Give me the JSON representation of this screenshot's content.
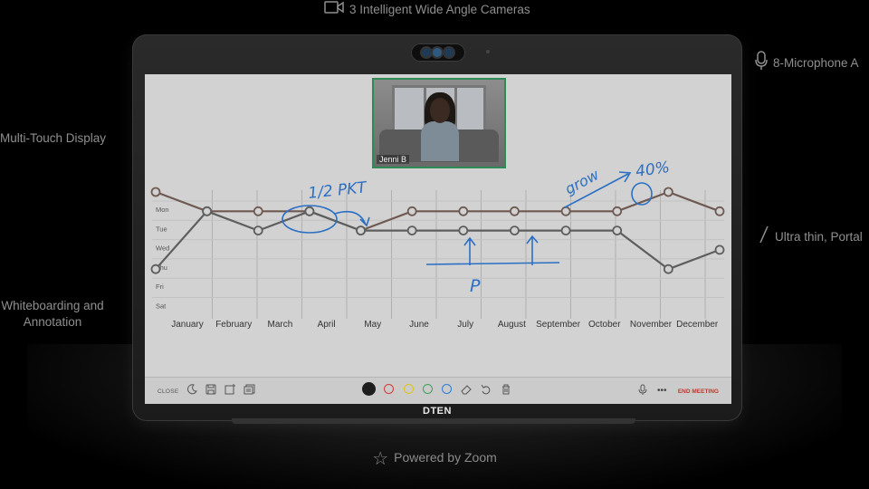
{
  "features": {
    "cameras": "3 Intelligent Wide Angle Cameras",
    "microphones": "8-Microphone A",
    "touch": "Multi-Touch Display",
    "thin": "Ultra thin, Portal",
    "whiteboard": "Whiteboarding and Annotation"
  },
  "device": {
    "brand": "DTEN"
  },
  "video": {
    "participant_name": "Jenni B"
  },
  "chart_data": {
    "type": "line",
    "categories": [
      "January",
      "February",
      "March",
      "April",
      "May",
      "June",
      "July",
      "August",
      "September",
      "October",
      "November",
      "December"
    ],
    "y_categories": [
      "Mon",
      "Tue",
      "Wed",
      "Thu",
      "Fri",
      "Sat"
    ],
    "series": [
      {
        "values": [
          "Mon",
          "Tue",
          "Tue",
          "Tue",
          "Wed",
          "Tue",
          "Tue",
          "Tue",
          "Tue",
          "Tue",
          "Mon",
          "Tue"
        ],
        "color": "#6e5a52"
      },
      {
        "values": [
          "Fri",
          "Tue",
          "Wed",
          "Tue",
          "Wed",
          "Wed",
          "Wed",
          "Wed",
          "Wed",
          "Wed",
          "Fri",
          "Thu"
        ],
        "color": "#5e5e5e"
      }
    ],
    "plotted_x": [
      0,
      1,
      2,
      3,
      4,
      5,
      6,
      7,
      8,
      9,
      10,
      11
    ],
    "annotations": [
      "1/2 PKT",
      "P",
      "grow",
      "40%"
    ],
    "grid": true
  },
  "toolbar": {
    "close_label": "CLOSE",
    "end_meeting_label": "END MEETING",
    "colors": [
      "#1e1e1e",
      "#d23b3b",
      "#e0c21b",
      "#3aa35a",
      "#2e7bd6"
    ]
  },
  "footer": {
    "powered_by": "Powered by Zoom"
  }
}
